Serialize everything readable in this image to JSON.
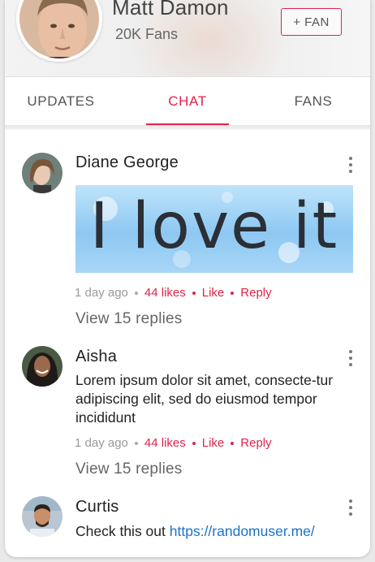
{
  "profile": {
    "name": "Matt Damon",
    "fans": "20K Fans",
    "fan_button": "+ FAN"
  },
  "tabs": [
    {
      "label": "UPDATES",
      "active": false
    },
    {
      "label": "CHAT",
      "active": true
    },
    {
      "label": "FANS",
      "active": false
    }
  ],
  "accent_color": "#e0234a",
  "link_color": "#1a73c9",
  "comments": [
    {
      "author": "Diane George",
      "image_text": "I love it",
      "time": "1 day ago",
      "likes": "44 likes",
      "like_label": "Like",
      "reply_label": "Reply",
      "view_replies": "View 15 replies"
    },
    {
      "author": "Aisha",
      "text": "Lorem ipsum dolor sit amet, consecte-tur adipiscing elit, sed do eiusmod tempor incididunt",
      "time": "1 day ago",
      "likes": "44 likes",
      "like_label": "Like",
      "reply_label": "Reply",
      "view_replies": "View 15 replies"
    },
    {
      "author": "Curtis",
      "text": "Check this out",
      "link": "https://randomuser.me/"
    }
  ]
}
